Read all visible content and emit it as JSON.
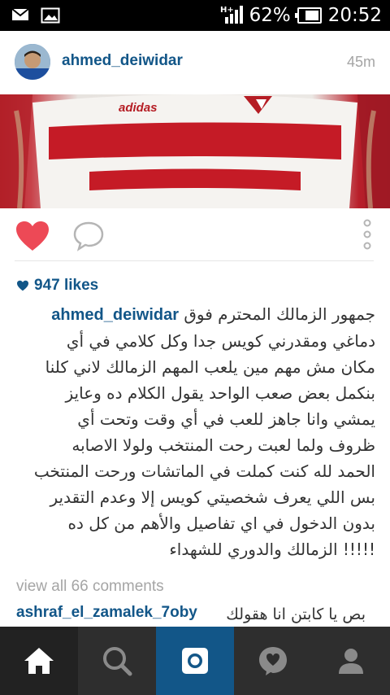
{
  "status_bar": {
    "network_label": "H+",
    "battery_percent": "62%",
    "time": "20:52",
    "icons": [
      "mail-icon",
      "gallery-icon",
      "signal-icon",
      "battery-icon"
    ]
  },
  "post": {
    "username": "ahmed_deiwidar",
    "time_ago": "45m",
    "likes": "947 likes",
    "caption_user": "ahmed_deiwidar",
    "caption_lines": [
      "جمهور الزمالك المحترم فوق",
      "دماغي ومقدرني كويس جدا وكل كلامي في أي",
      "مكان مش مهم مين يلعب المهم الزمالك لاني كلنا",
      "بنكمل بعض صعب الواحد يقول الكلام ده وعايز",
      "يمشي وانا جاهز للعب في أي وقت وتحت أي",
      "ظروف ولما لعبت رحت المنتخب ولولا الاصابه",
      "الحمد لله كنت كملت في الماتشات ورحت المنتخب",
      "بس اللي يعرف شخصيتي كويس إلا وعدم التقدير",
      "بدون الدخول في اي تفاصيل والأهم من كل ده",
      "!!!!! الزمالك والدوري للشهداء"
    ],
    "view_comments": "view all 66 comments",
    "comment": {
      "user": "ashraf_el_zamalek_7oby",
      "text": "بص يا كابتن انا هقولك"
    }
  },
  "photo": {
    "brand_text": "adidas"
  },
  "colors": {
    "link": "#125688",
    "heart": "#ed4956",
    "nav_bg": "#2e2e2e",
    "camera_tab": "#125688"
  },
  "bottom_nav": [
    "home-icon",
    "search-icon",
    "camera-icon",
    "activity-icon",
    "profile-icon"
  ]
}
